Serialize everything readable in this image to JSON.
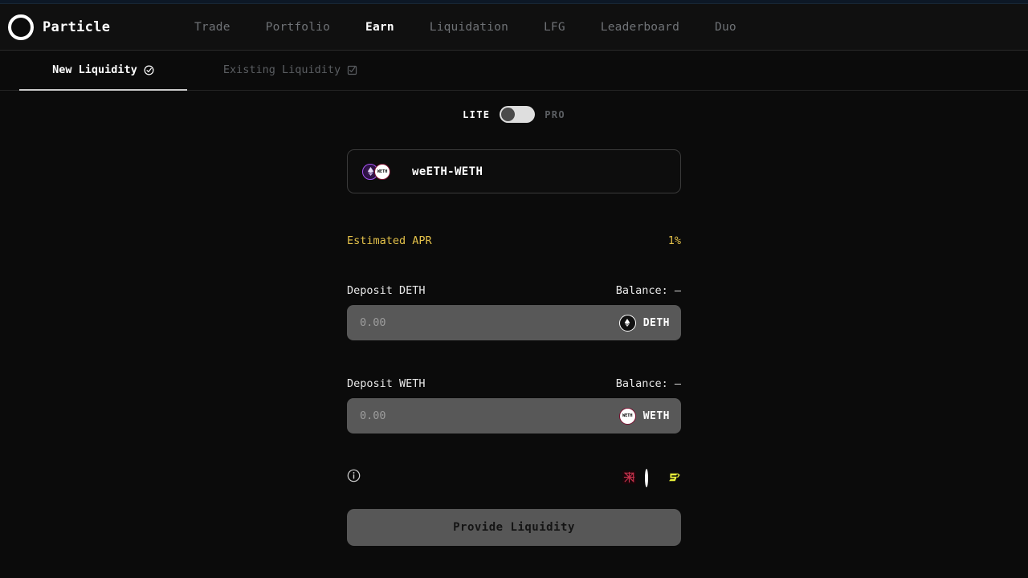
{
  "header": {
    "brand": "Particle",
    "logo_icon": "particle-ring-logo",
    "nav": [
      {
        "label": "Trade",
        "active": false
      },
      {
        "label": "Portfolio",
        "active": false
      },
      {
        "label": "Earn",
        "active": true
      },
      {
        "label": "Liquidation",
        "active": false
      },
      {
        "label": "LFG",
        "active": false
      },
      {
        "label": "Leaderboard",
        "active": false
      },
      {
        "label": "Duo",
        "active": false
      }
    ]
  },
  "subtabs": [
    {
      "label": "New Liquidity",
      "icon": "check-circle-icon",
      "active": true
    },
    {
      "label": "Existing Liquidity",
      "icon": "check-square-icon",
      "active": false
    }
  ],
  "mode": {
    "lite_label": "LITE",
    "pro_label": "PRO",
    "selected": "LITE"
  },
  "pair": {
    "name": "weETH-WETH",
    "token_a_icon": "weeth-token-icon",
    "token_b_icon": "weth-token-icon",
    "token_b_text": "WETH"
  },
  "apr": {
    "label": "Estimated APR",
    "value": "1%",
    "color": "#e3c14a"
  },
  "deposits": [
    {
      "label": "Deposit DETH",
      "balance_label": "Balance: –",
      "placeholder": "0.00",
      "value": "",
      "symbol": "DETH",
      "icon": "deth-token-icon"
    },
    {
      "label": "Deposit WETH",
      "balance_label": "Balance: –",
      "placeholder": "0.00",
      "value": "",
      "symbol": "WETH",
      "icon": "weth-token-icon"
    }
  ],
  "meta": {
    "info_icon": "info-circle-icon",
    "protocols": [
      {
        "icon": "crossed-square-icon",
        "color": "#c0304a"
      },
      {
        "icon": "particle-ring-icon",
        "color": "#ffffff"
      },
      {
        "icon": "blast-b-icon",
        "color": "#e8f03a"
      }
    ]
  },
  "cta": {
    "label": "Provide Liquidity"
  }
}
